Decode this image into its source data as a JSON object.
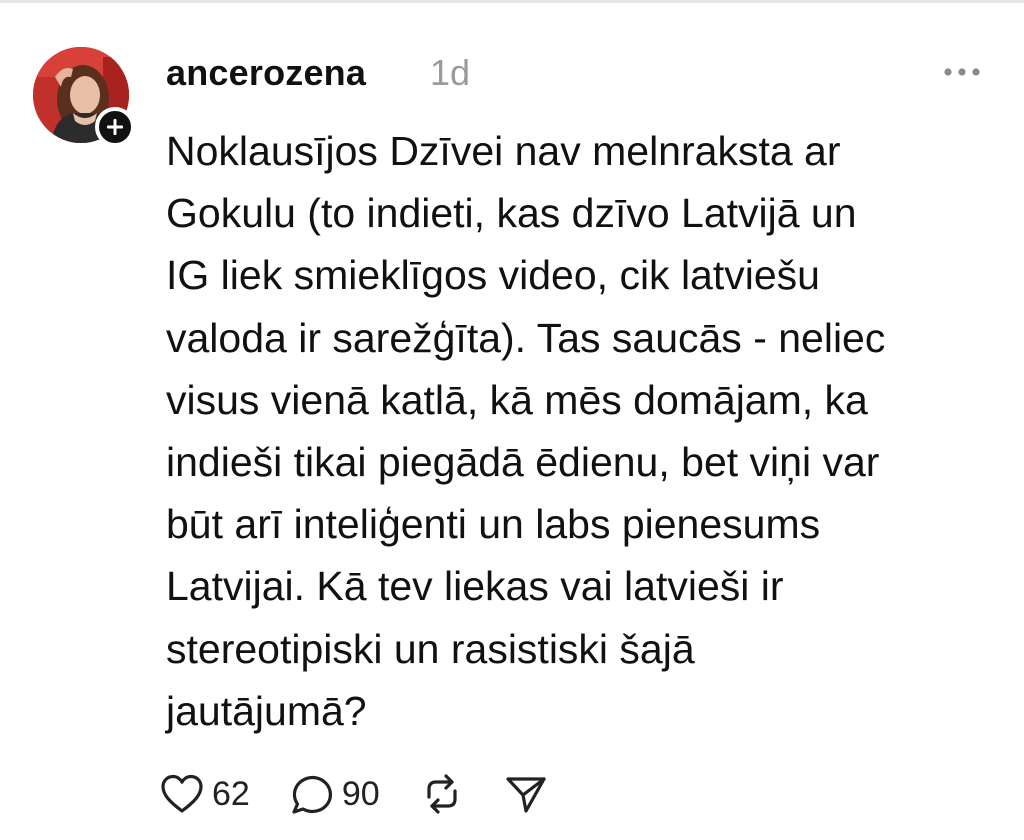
{
  "post": {
    "username": "ancerozena",
    "timestamp": "1d",
    "text": "Noklausījos Dzīvei nav melnraksta ar\nGokulu (to indieti, kas dzīvo Latvijā un\nIG liek smieklīgos video, cik latviešu\nvaloda ir sarežģīta). Tas saucās - neliec\nvisus vienā katlā, kā mēs domājam, ka\nindieši tikai piegādā ēdienu, bet viņi var\nbūt arī inteliģenti un labs pienesums\nLatvijai. Kā tev liekas vai latvieši ir\nstereotipiski un rasistiski šajā\njautājumā?",
    "likes": "62",
    "replies": "90"
  },
  "icons": {
    "avatar": "user-avatar-photo",
    "follow": "plus-icon",
    "more": "more-horizontal-icon",
    "like": "heart-icon",
    "reply": "comment-icon",
    "repost": "repost-icon",
    "share": "send-icon"
  },
  "colors": {
    "text": "#111111",
    "muted": "#9a9a9a",
    "avatar_bg": "#c2302b"
  }
}
